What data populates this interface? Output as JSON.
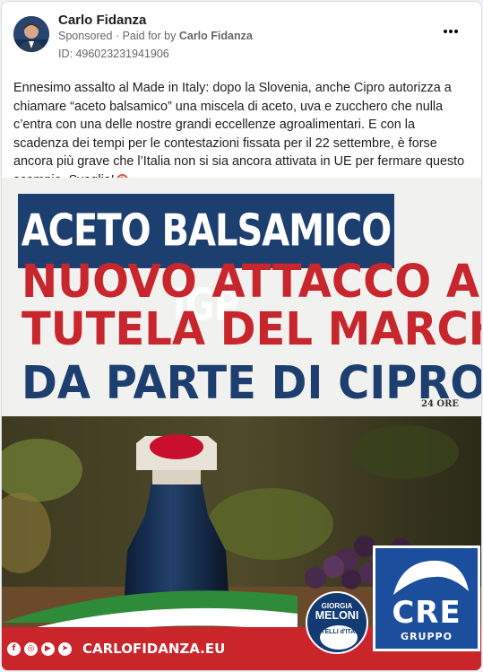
{
  "post": {
    "author": "Carlo Fidanza",
    "sponsored_label": "Sponsored",
    "paid_for_prefix": "Paid for by",
    "paid_for_by": "Carlo Fidanza",
    "id_text": "ID: 496023231941906",
    "body": "Ennesimo assalto al Made in Italy: dopo la Slovenia, anche Cipro autorizza a chiamare “aceto balsamico” una miscela di aceto, uva e zucchero che nulla c’entra con una delle nostre grandi eccellenze agroalimentari. E con la scadenza dei tempi per le contestazioni fissata per il 22 settembre, è forse ancora più grave che l’Italia non si sia ancora attivata in UE per fermare questo scempio. Sveglia!"
  },
  "creative": {
    "headline_top": "ACETO BALSAMICO IGP",
    "headline_line1": "NUOVO ATTACCO ALLA",
    "headline_line2": "TUTELA DEL MARCHIO",
    "headline_line3": "DA PARTE DI CIPRO",
    "source_tag": "24 ORE",
    "website": "CARLOFIDANZA.EU",
    "social_icons": [
      "facebook-icon",
      "instagram-icon",
      "youtube-icon",
      "telegram-icon"
    ],
    "logo_meloni_top": "GIORGIA",
    "logo_meloni_name": "MELONI",
    "logo_meloni_party": "FRATELLI d'ITALIA",
    "logo_cre": "CRE",
    "logo_cre_sub": "GRUPPO"
  },
  "colors": {
    "navy": "#1d3f6f",
    "red": "#c7262c",
    "green": "#2e8b3a",
    "facebook_blue": "#1877f2"
  }
}
